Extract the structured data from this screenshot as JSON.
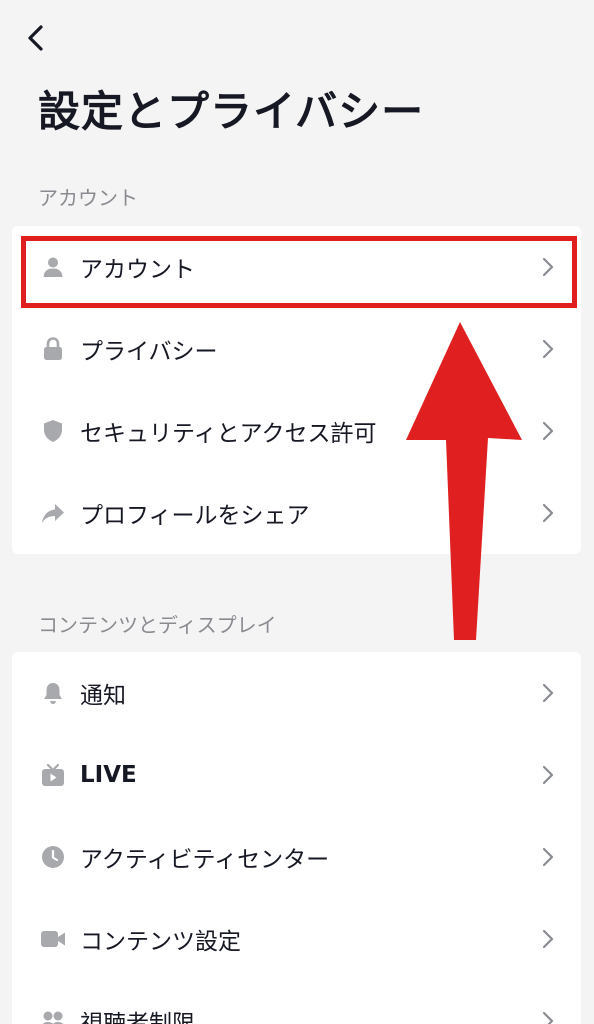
{
  "header": {
    "title": "設定とプライバシー"
  },
  "sections": [
    {
      "label": "アカウント",
      "items": [
        {
          "label": "アカウント",
          "icon": "person-icon"
        },
        {
          "label": "プライバシー",
          "icon": "lock-icon"
        },
        {
          "label": "セキュリティとアクセス許可",
          "icon": "shield-icon"
        },
        {
          "label": "プロフィールをシェア",
          "icon": "share-arrow-icon"
        }
      ]
    },
    {
      "label": "コンテンツとディスプレイ",
      "items": [
        {
          "label": "通知",
          "icon": "bell-icon"
        },
        {
          "label": "LIVE",
          "icon": "tv-icon"
        },
        {
          "label": "アクティビティセンター",
          "icon": "clock-icon"
        },
        {
          "label": "コンテンツ設定",
          "icon": "video-camera-icon"
        },
        {
          "label": "視聴者制限",
          "icon": "people-icon"
        }
      ]
    }
  ],
  "colors": {
    "highlight": "#e02020",
    "icon": "#a8a9ad",
    "background": "#f4f4f4"
  }
}
